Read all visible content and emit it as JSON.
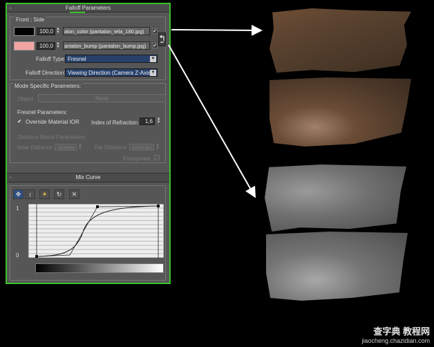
{
  "falloff": {
    "title": "Falloff Parameters",
    "front_side_label": "Front : Side",
    "slot1": {
      "amount": "100,0",
      "map_label": "alon_color (pantalon_tela_180.jpg)",
      "enabled": true,
      "color": "#000000"
    },
    "slot2": {
      "amount": "100,0",
      "map_label": "antalon_bump (pantalon_bump.jpg)",
      "enabled": true,
      "color": "#f4a3a3"
    },
    "swap_icon": "swap-arrows-icon",
    "type_label": "Falloff Type:",
    "type_value": "Fresnel",
    "direction_label": "Falloff Direction:",
    "direction_value": "Viewing Direction (Camera Z-Axis)"
  },
  "mode": {
    "title": "Mode Specific Parameters:",
    "object_label": "Object:",
    "object_value": "None",
    "fresnel_title": "Fresnel Parameters:",
    "override_ior_label": "Override Material IOR",
    "override_ior_checked": true,
    "ior_label": "Index of Refraction",
    "ior_value": "1,6",
    "distance_blend_title": "Distance Blend Parameters:",
    "near_label": "Near Distance:",
    "near_value": "0,0mm",
    "far_label": "Far Distance:",
    "far_value": "1000,0m",
    "extrapolate_label": "Extrapolate"
  },
  "mix_curve": {
    "title": "Mix Curve",
    "tools": [
      "move-icon",
      "scale-vertical-icon",
      "add-point-icon",
      "reset-icon",
      "delete-icon"
    ],
    "y_max": "1",
    "y_min": "0"
  },
  "arrow_color": "#ffffff",
  "panel_border_color": "#39c12a",
  "watermark": {
    "title": "查字典 教程网",
    "url": "jiaocheng.chazidian.com"
  }
}
